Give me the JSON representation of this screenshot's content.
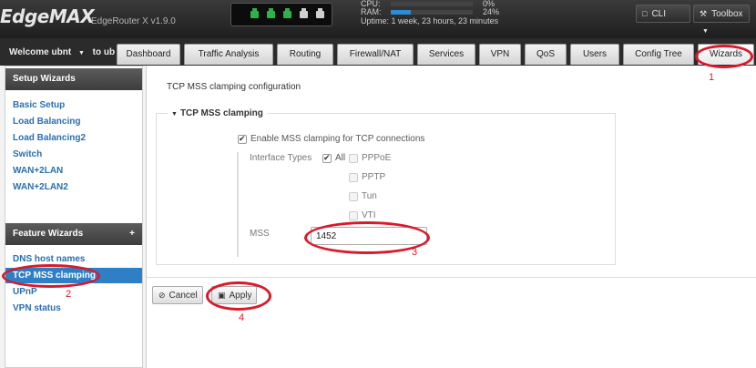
{
  "header": {
    "logo": "EdgeMAX",
    "model": "EdgeRouter X v1.9.0",
    "stats": {
      "cpu_label": "CPU:",
      "cpu_value": "0%",
      "cpu_fill": 0.0,
      "ram_label": "RAM:",
      "ram_value": "24%",
      "ram_fill": 0.24,
      "uptime": "Uptime: 1 week, 23 hours, 23 minutes"
    },
    "port_color": "#2db34a",
    "cli_label": "CLI",
    "toolbox_label": "Toolbox"
  },
  "nav": {
    "welcome": "Welcome ubnt",
    "welcome_suffix": "to ub",
    "tabs": [
      {
        "label": "Dashboard"
      },
      {
        "label": "Traffic Analysis"
      },
      {
        "label": "Routing"
      },
      {
        "label": "Firewall/NAT"
      },
      {
        "label": "Services"
      },
      {
        "label": "VPN"
      },
      {
        "label": "QoS"
      },
      {
        "label": "Users"
      },
      {
        "label": "Config Tree"
      },
      {
        "label": "Wizards"
      }
    ]
  },
  "sidebar": {
    "setup_title": "Setup Wizards",
    "setup_items": [
      {
        "label": "Basic Setup"
      },
      {
        "label": "Load Balancing"
      },
      {
        "label": "Load Balancing2"
      },
      {
        "label": "Switch"
      },
      {
        "label": "WAN+2LAN"
      },
      {
        "label": "WAN+2LAN2"
      }
    ],
    "feature_title": "Feature Wizards",
    "feature_plus": "+",
    "feature_items": [
      {
        "label": "DNS host names"
      },
      {
        "label": "TCP MSS clamping"
      },
      {
        "label": "UPnP"
      },
      {
        "label": "VPN status"
      }
    ]
  },
  "main": {
    "title": "TCP MSS clamping configuration",
    "section_title": "TCP MSS clamping",
    "enable_label": "Enable MSS clamping for TCP connections",
    "interface_types_label": "Interface Types",
    "types": [
      {
        "label": "All",
        "checked": true
      },
      {
        "label": "PPPoE",
        "checked": false
      },
      {
        "label": "PPTP",
        "checked": false
      },
      {
        "label": "Tun",
        "checked": false
      },
      {
        "label": "VTI",
        "checked": false
      }
    ],
    "mss_label": "MSS",
    "mss_value": "1452",
    "cancel_label": "Cancel",
    "apply_label": "Apply"
  },
  "annotations": {
    "color": "#d81a2b",
    "labels": [
      "1",
      "2",
      "3",
      "4"
    ]
  }
}
